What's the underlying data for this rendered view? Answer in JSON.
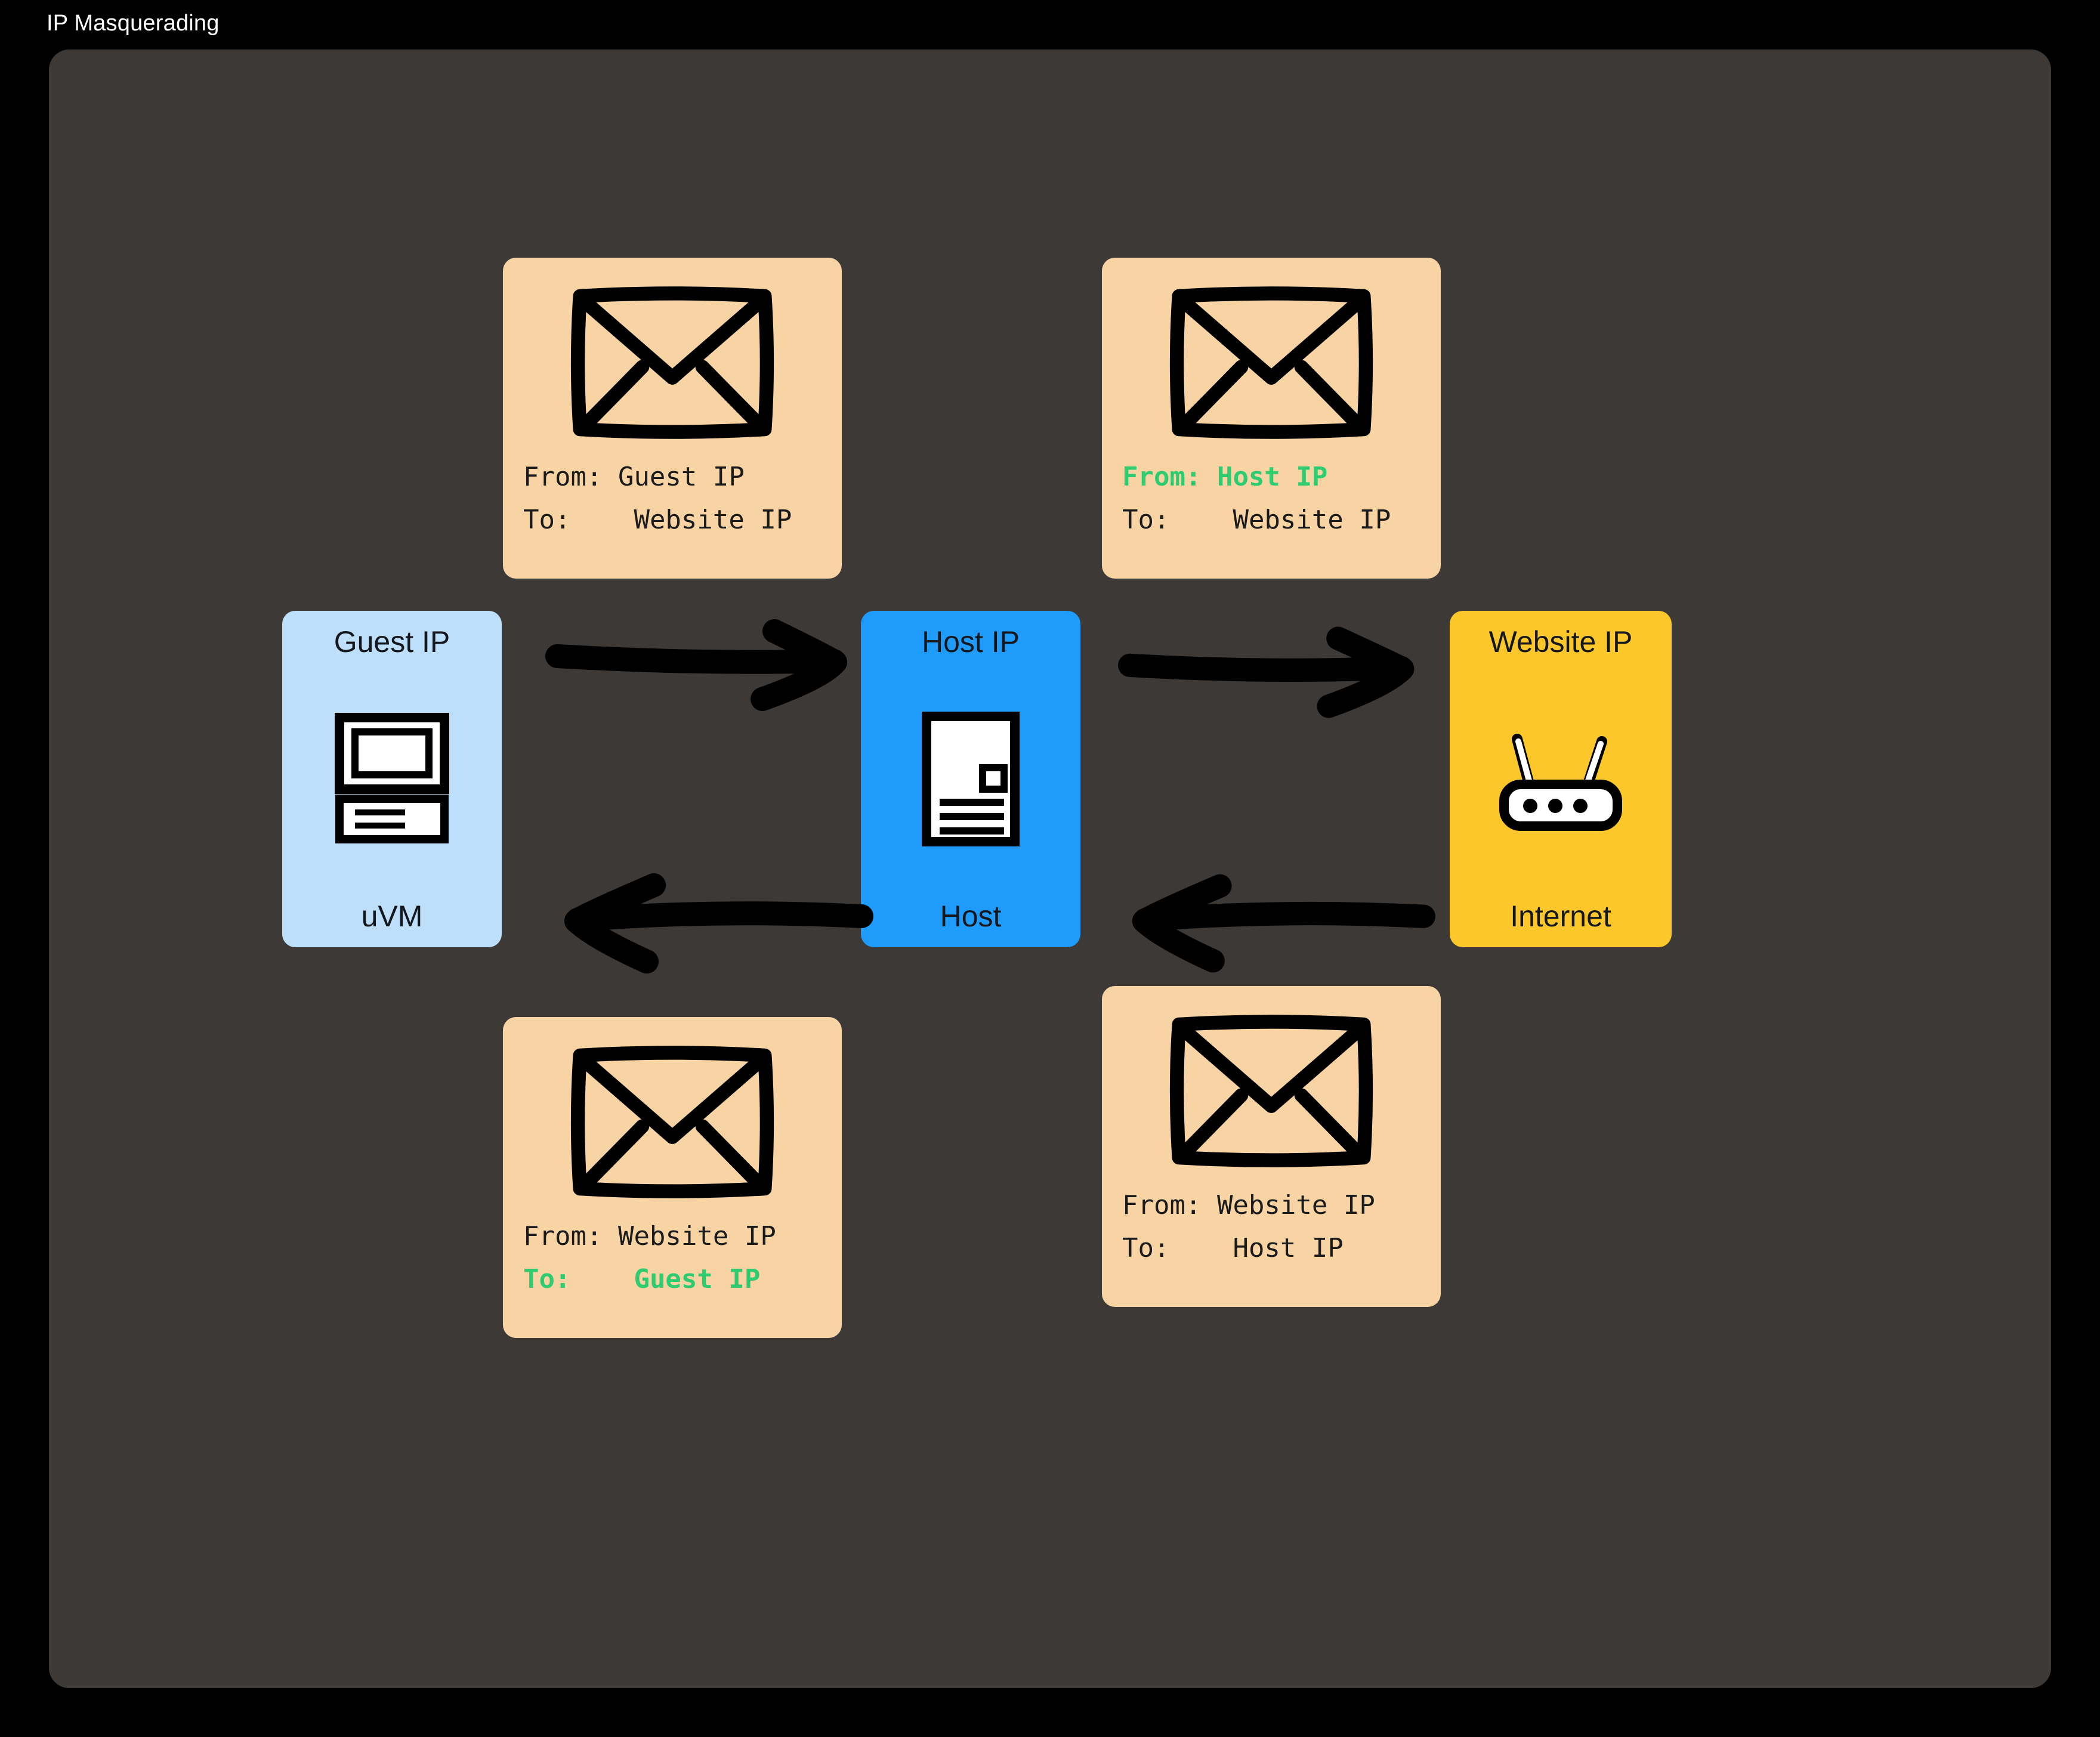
{
  "window": {
    "title": "IP Masquerading"
  },
  "theme": {
    "page_background": "#000000",
    "canvas_background": "#3D3937",
    "packet_card_color": "#F8D3A4",
    "highlight_green": "#2ECC71",
    "uvm_color": "#BEDFFA",
    "host_color": "#1E9BFB",
    "internet_color": "#FBC72A",
    "ink": "#000000"
  },
  "diagram": {
    "type": "network-flow",
    "nodes": [
      {
        "id": "uvm",
        "top_label": "Guest IP",
        "bottom_label": "uVM",
        "icon": "computer-icon",
        "color": "#BEDFFA"
      },
      {
        "id": "host",
        "top_label": "Host IP",
        "bottom_label": "Host",
        "icon": "server-document-icon",
        "color": "#1E9BFB"
      },
      {
        "id": "internet",
        "top_label": "Website IP",
        "bottom_label": "Internet",
        "icon": "router-icon",
        "color": "#FBC72A"
      }
    ],
    "arrows": [
      {
        "id": "uvm-to-host",
        "direction": "right",
        "row": "top"
      },
      {
        "id": "host-to-internet",
        "direction": "right",
        "row": "top"
      },
      {
        "id": "host-to-uvm",
        "direction": "left",
        "row": "bottom"
      },
      {
        "id": "internet-to-host",
        "direction": "left",
        "row": "bottom"
      }
    ],
    "packets": [
      {
        "id": "packet-outbound-guest",
        "icon": "envelope-icon",
        "lines": [
          {
            "key": "From:",
            "value": "Guest IP",
            "highlighted": false
          },
          {
            "key": "To:",
            "value": "Website IP",
            "highlighted": false
          }
        ]
      },
      {
        "id": "packet-outbound-masqueraded",
        "icon": "envelope-icon",
        "lines": [
          {
            "key": "From:",
            "value": "Host IP",
            "highlighted": true
          },
          {
            "key": "To:",
            "value": "Website IP",
            "highlighted": false
          }
        ]
      },
      {
        "id": "packet-inbound-translated",
        "icon": "envelope-icon",
        "lines": [
          {
            "key": "From:",
            "value": "Website IP",
            "highlighted": false
          },
          {
            "key": "To:",
            "value": "Guest IP",
            "highlighted": true
          }
        ]
      },
      {
        "id": "packet-inbound-host",
        "icon": "envelope-icon",
        "lines": [
          {
            "key": "From:",
            "value": "Website IP",
            "highlighted": false
          },
          {
            "key": "To:",
            "value": "Host IP",
            "highlighted": false
          }
        ]
      }
    ]
  }
}
